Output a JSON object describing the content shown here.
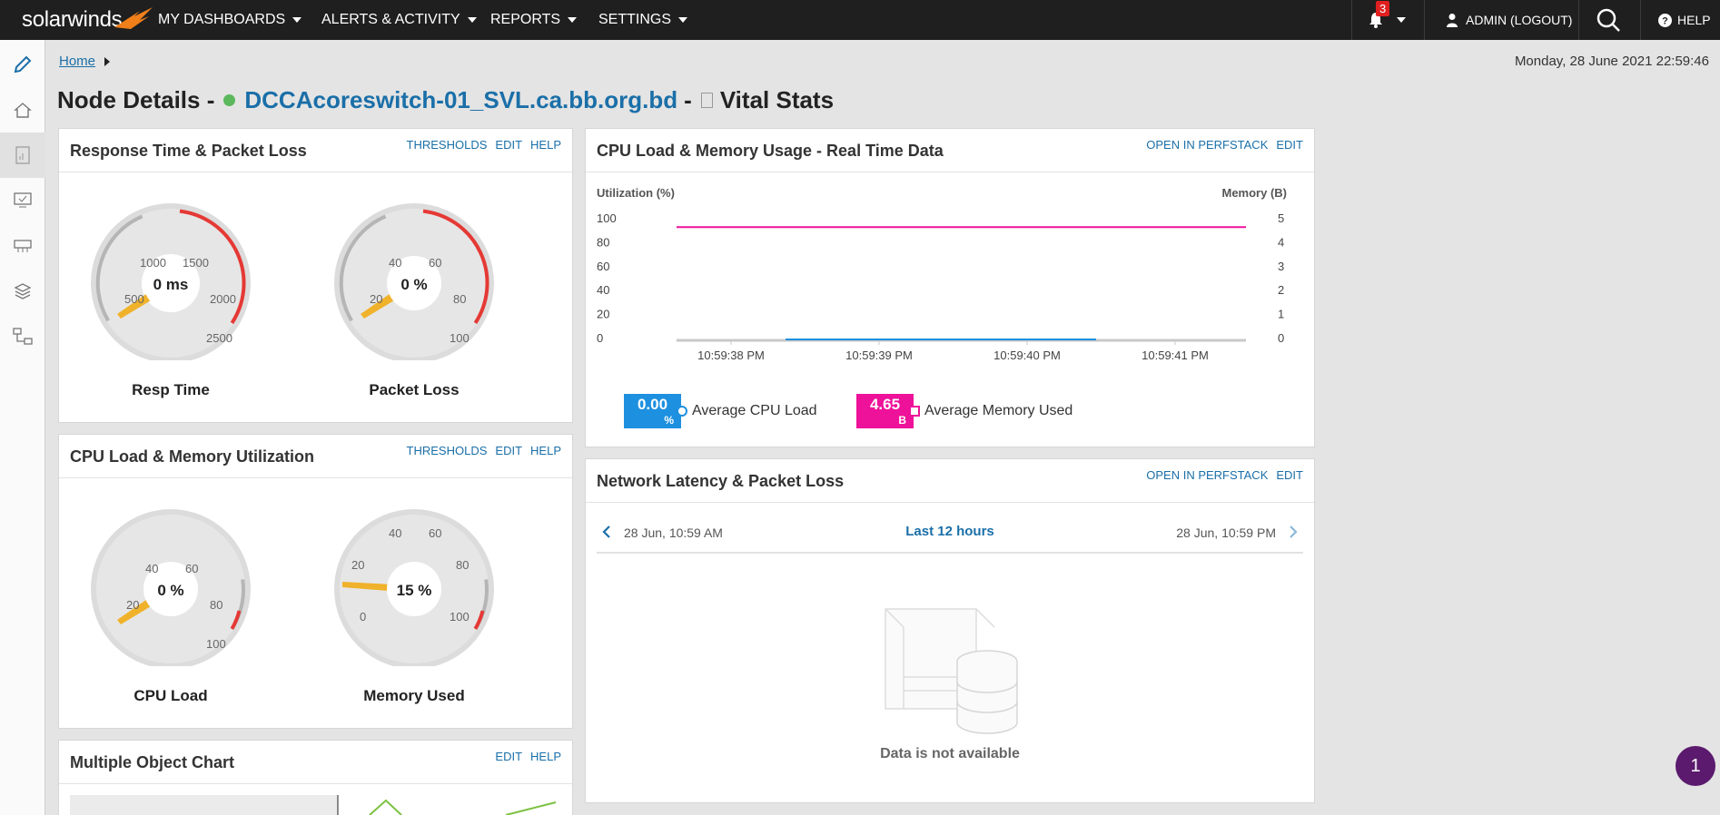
{
  "app": {
    "logo_text": "solarwinds",
    "colors": {
      "topbar": "#1f1f1f",
      "link": "#1a6fa8",
      "status_up": "#5cb85c",
      "cpu_series": "#1e90e0",
      "memory_series": "#ee1199",
      "gauge_warning": "#f0b22a",
      "gauge_critical": "#e53935"
    }
  },
  "nav": {
    "items": [
      {
        "label": "MY DASHBOARDS"
      },
      {
        "label": "ALERTS & ACTIVITY"
      },
      {
        "label": "REPORTS"
      },
      {
        "label": "SETTINGS"
      }
    ],
    "notification_count": "3",
    "user_label": "ADMIN (LOGOUT)",
    "help_label": "HELP"
  },
  "rail": {
    "icons": [
      "pencil-icon",
      "home-icon",
      "report-icon",
      "monitor-icon",
      "network-switch-icon",
      "layers-icon",
      "topology-icon"
    ]
  },
  "breadcrumb": {
    "home": "Home"
  },
  "timestamp": "Monday, 28 June 2021 22:59:46",
  "title": {
    "prefix": "Node Details -",
    "node": "DCCAcoreswitch-01_SVL.ca.bb.org.bd",
    "separator": "-",
    "view": "Vital Stats"
  },
  "panels": {
    "response_time": {
      "title": "Response Time & Packet Loss",
      "actions": [
        "THRESHOLDS",
        "EDIT",
        "HELP"
      ],
      "gauges": [
        {
          "label": "Resp Time",
          "value_text": "0 ms",
          "ticks": [
            "500",
            "1000",
            "1500",
            "2000",
            "2500",
            "0"
          ]
        },
        {
          "label": "Packet Loss",
          "value_text": "0 %",
          "ticks": [
            "20",
            "40",
            "60",
            "80",
            "100",
            "0"
          ]
        }
      ]
    },
    "cpu_memory_util": {
      "title": "CPU Load & Memory Utilization",
      "actions": [
        "THRESHOLDS",
        "EDIT",
        "HELP"
      ],
      "gauges": [
        {
          "label": "CPU Load",
          "value_text": "0 %",
          "ticks": [
            "20",
            "40",
            "60",
            "80",
            "100",
            "0"
          ]
        },
        {
          "label": "Memory Used",
          "value_text": "15 %",
          "ticks": [
            "20",
            "40",
            "60",
            "80",
            "100",
            "0"
          ]
        }
      ]
    },
    "multi_object": {
      "title": "Multiple Object Chart",
      "actions": [
        "EDIT",
        "HELP"
      ]
    },
    "realtime": {
      "title": "CPU Load & Memory Usage - Real Time Data",
      "actions": [
        "OPEN IN PERFSTACK",
        "EDIT"
      ],
      "legend": [
        {
          "value": "0.00",
          "unit": "%",
          "label": "Average CPU Load"
        },
        {
          "value": "4.65",
          "unit": "B",
          "label": "Average Memory Used"
        }
      ]
    },
    "network_latency": {
      "title": "Network Latency & Packet Loss",
      "actions": [
        "OPEN IN PERFSTACK",
        "EDIT"
      ],
      "range_start": "28 Jun, 10:59 AM",
      "range_label": "Last 12 hours",
      "range_end": "28 Jun, 10:59 PM",
      "empty_message": "Data is not available"
    }
  },
  "chart_data": {
    "type": "line",
    "title": "",
    "ylabel": "Utilization (%)",
    "y2label": "Memory (B)",
    "x": [
      "10:59:38 PM",
      "10:59:39 PM",
      "10:59:40 PM",
      "10:59:41 PM"
    ],
    "yticks": [
      "100",
      "80",
      "60",
      "40",
      "20",
      "0"
    ],
    "y2ticks": [
      "5",
      "4",
      "3",
      "2",
      "1",
      "0"
    ],
    "ylim": [
      0,
      100
    ],
    "y2lim": [
      0,
      5
    ],
    "series": [
      {
        "name": "Average CPU Load",
        "axis": "left",
        "values": [
          0,
          0,
          0,
          0
        ]
      },
      {
        "name": "Average Memory Used",
        "axis": "right",
        "values": [
          4.65,
          4.65,
          4.65,
          4.65
        ]
      }
    ]
  },
  "floating_badge": "1"
}
